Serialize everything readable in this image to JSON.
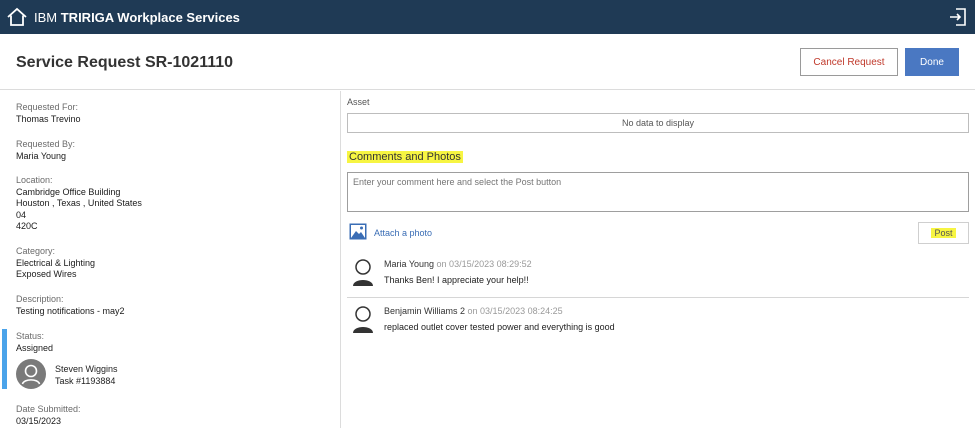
{
  "appbar": {
    "brand_prefix": "IBM ",
    "brand_name": "TRIRIGA Workplace Services",
    "icons": {
      "home": "home-icon",
      "exit": "exit-icon"
    }
  },
  "header": {
    "title": "Service Request SR-1021110",
    "cancel_label": "Cancel Request",
    "done_label": "Done",
    "colors": {
      "cancel_text": "#c0392b",
      "done_bg": "#4a78c2",
      "appbar_bg": "#1f3a55"
    }
  },
  "details": {
    "requested_for": {
      "label": "Requested For:",
      "value": "Thomas Trevino"
    },
    "requested_by": {
      "label": "Requested By:",
      "value": "Maria Young"
    },
    "location": {
      "label": "Location:",
      "lines": [
        "Cambridge Office Building",
        "Houston , Texas , United States",
        "04",
        "420C"
      ]
    },
    "category": {
      "label": "Category:",
      "lines": [
        "Electrical & Lighting",
        "Exposed Wires"
      ]
    },
    "description": {
      "label": "Description:",
      "value": "Testing notifications - may2"
    },
    "status": {
      "label": "Status:",
      "value": "Assigned",
      "accent": "#4aa3ea"
    },
    "assignee": {
      "name": "Steven Wiggins",
      "task": "Task #1193884",
      "icon": "user-avatar-icon"
    },
    "date_submitted": {
      "label": "Date Submitted:",
      "value": "03/15/2023"
    }
  },
  "asset": {
    "label": "Asset",
    "empty_text": "No data to display"
  },
  "comments": {
    "title": "Comments and Photos",
    "placeholder": "Enter your comment here and select the Post button",
    "attach_label": "Attach a photo",
    "post_label": "Post",
    "highlight": "#f7f542",
    "items": [
      {
        "author": "Maria Young",
        "on": " on 03/15/2023 08:29:52",
        "text": "Thanks Ben! I appreciate your help!!"
      },
      {
        "author": "Benjamin Williams 2",
        "on": " on 03/15/2023 08:24:25",
        "text": "replaced outlet cover tested power and everything is good"
      }
    ]
  }
}
